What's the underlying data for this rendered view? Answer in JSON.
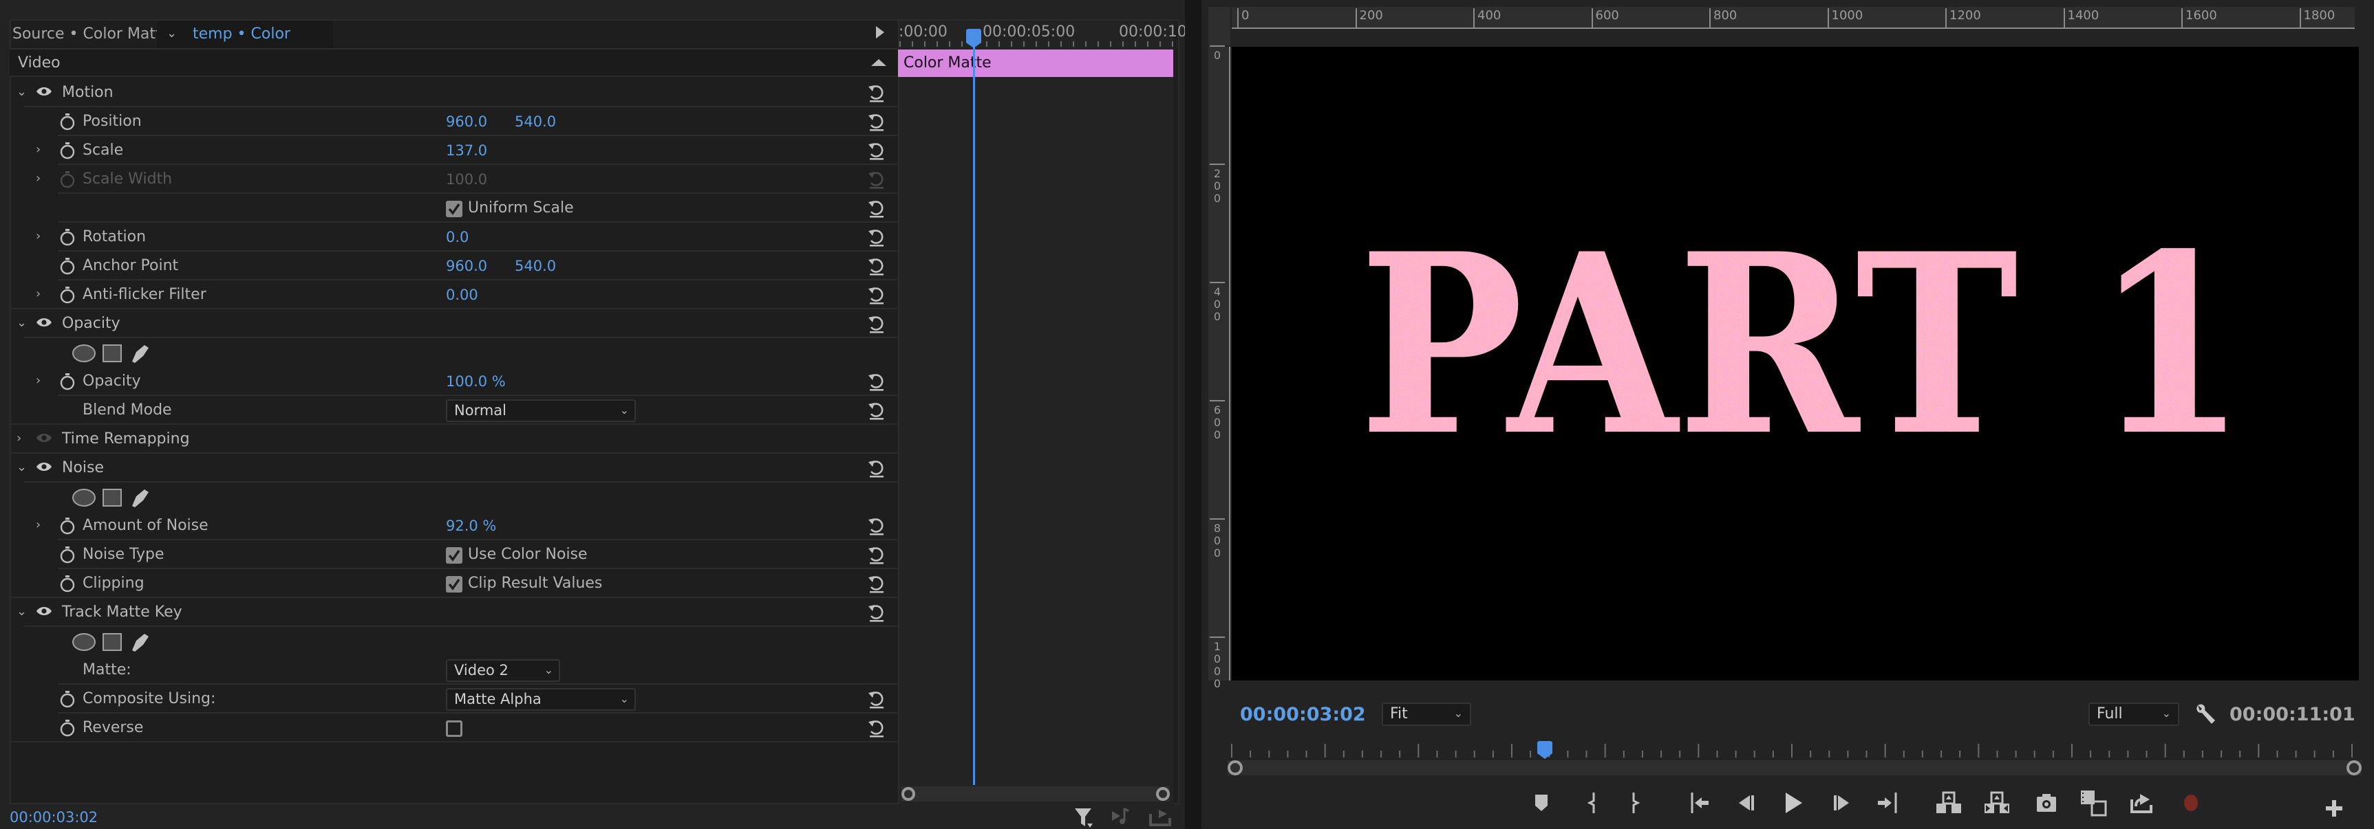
{
  "effect_controls": {
    "tab_source": "Source • Color Matte",
    "tab_sequence": "temp • Color Matte",
    "section_header": "Video",
    "groups": [
      {
        "name": "Motion",
        "expanded": true,
        "enabled": true,
        "properties": [
          {
            "label": "Position",
            "twirl": false,
            "values": [
              "960.0",
              "540.0"
            ]
          },
          {
            "label": "Scale",
            "twirl": true,
            "values": [
              "137.0"
            ]
          },
          {
            "label": "Scale Width",
            "twirl": true,
            "values": [
              "100.0"
            ],
            "disabled": true
          },
          {
            "label": "",
            "checkbox": {
              "checked": true,
              "label": "Uniform Scale"
            }
          },
          {
            "label": "Rotation",
            "twirl": true,
            "values": [
              "0.0"
            ]
          },
          {
            "label": "Anchor Point",
            "twirl": false,
            "values": [
              "960.0",
              "540.0"
            ]
          },
          {
            "label": "Anti-flicker Filter",
            "twirl": true,
            "values": [
              "0.00"
            ]
          }
        ]
      },
      {
        "name": "Opacity",
        "expanded": true,
        "enabled": true,
        "mask_tools": [
          "ellipse-mask",
          "rectangle-mask",
          "pen-mask"
        ],
        "properties": [
          {
            "label": "Opacity",
            "twirl": true,
            "values": [
              "100.0 %"
            ]
          },
          {
            "label": "Blend Mode",
            "dropdown": "Normal"
          }
        ]
      },
      {
        "name": "Time Remapping",
        "expanded": false,
        "enabled": false
      },
      {
        "name": "Noise",
        "expanded": true,
        "enabled": true,
        "mask_tools": [
          "ellipse-mask",
          "rectangle-mask",
          "pen-mask"
        ],
        "properties": [
          {
            "label": "Amount of Noise",
            "twirl": true,
            "values": [
              "92.0 %"
            ]
          },
          {
            "label": "Noise Type",
            "checkbox": {
              "checked": true,
              "label": "Use Color Noise"
            }
          },
          {
            "label": "Clipping",
            "checkbox": {
              "checked": true,
              "label": "Clip Result Values"
            }
          }
        ]
      },
      {
        "name": "Track Matte Key",
        "expanded": true,
        "enabled": true,
        "mask_tools": [
          "ellipse-mask",
          "rectangle-mask",
          "pen-mask"
        ],
        "properties": [
          {
            "label": "Matte:",
            "dropdown": "Video 2"
          },
          {
            "label": "Composite Using:",
            "dropdown": "Matte Alpha"
          },
          {
            "label": "Reverse",
            "checkbox": {
              "checked": false,
              "label": ""
            }
          }
        ]
      }
    ],
    "current_time": "00:00:03:02"
  },
  "mini_timeline": {
    "ruler_labels": [
      ":00:00",
      "00:00:05:00",
      "00:00:10:"
    ],
    "clip_label": "Color Matte",
    "clip_color": "#d787e0",
    "playhead_color": "#4a8ee8"
  },
  "program_monitor": {
    "h_ruler_labels": [
      "0",
      "200",
      "400",
      "600",
      "800",
      "1000",
      "1200",
      "1400",
      "1600",
      "1800"
    ],
    "v_ruler_labels": [
      "0",
      "200",
      "400",
      "600",
      "800",
      "1000"
    ],
    "frame_text": "PART 1",
    "current_time": "00:00:03:02",
    "zoom_level": "Fit",
    "resolution": "Full",
    "duration": "00:00:11:01",
    "playhead_position_fraction": 0.28,
    "transport_buttons": [
      "add-marker",
      "mark-in",
      "mark-out",
      "go-to-in",
      "step-back",
      "play",
      "step-forward",
      "go-to-out",
      "lift",
      "extract",
      "export-frame",
      "comparison-view",
      "export",
      "record",
      "button-editor"
    ]
  },
  "colors": {
    "accent_blue": "#5c9fe6",
    "panel_bg": "#232323",
    "clip_pink": "#d787e0",
    "record_red": "#7a2a22"
  }
}
